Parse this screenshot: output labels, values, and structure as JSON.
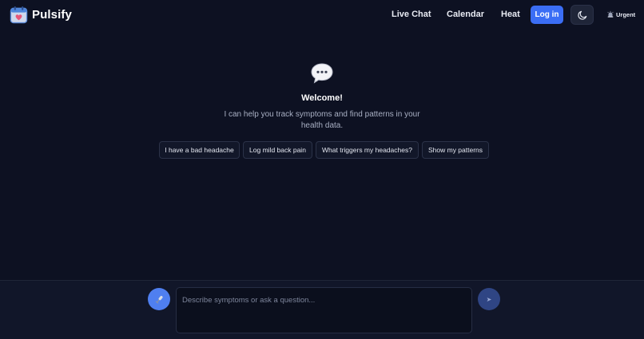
{
  "app": {
    "name": "Pulsify"
  },
  "nav": {
    "links": [
      {
        "label": "Live Chat"
      },
      {
        "label": "Calendar"
      },
      {
        "label": "Heat"
      }
    ],
    "login_label": "Log in",
    "urgent_label": "Urgent"
  },
  "welcome": {
    "title": "Welcome!",
    "description": "I can help you track symptoms and find patterns in your health data."
  },
  "suggestions": [
    {
      "label": "I have a bad headache"
    },
    {
      "label": "Log mild back pain"
    },
    {
      "label": "What triggers my headaches?"
    },
    {
      "label": "Show my patterns"
    }
  ],
  "composer": {
    "placeholder": "Describe symptoms or ask a question...",
    "value": "",
    "send_glyph": "➤"
  },
  "icons": {
    "logo": "calendar-heart-icon",
    "theme": "moon-icon",
    "urgent": "siren-icon",
    "welcome": "speech-bubble-icon",
    "mic": "microphone-icon",
    "send": "send-icon"
  },
  "colors": {
    "background": "#0d1122",
    "accent": "#3b6ef5",
    "mic": "#4f7ff0",
    "send": "#2f4584",
    "logo_heart": "#e8577a"
  }
}
